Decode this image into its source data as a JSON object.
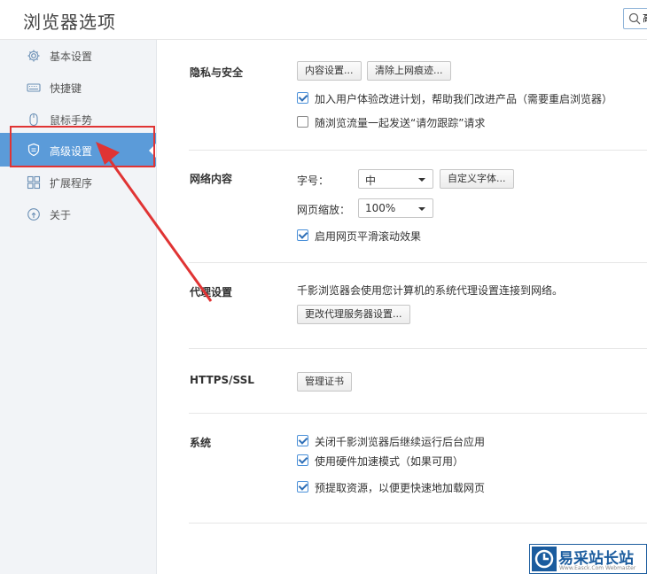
{
  "header": {
    "title": "浏览器选项",
    "search_value": "高",
    "search_icon": "search-icon"
  },
  "sidebar": {
    "items": [
      {
        "label": "基本设置",
        "icon": "gear-icon"
      },
      {
        "label": "快捷键",
        "icon": "keyboard-icon"
      },
      {
        "label": "鼠标手势",
        "icon": "mouse-icon"
      },
      {
        "label": "高级设置",
        "icon": "shield-icon",
        "active": true
      },
      {
        "label": "扩展程序",
        "icon": "extension-grid-icon"
      },
      {
        "label": "关于",
        "icon": "info-icon"
      }
    ]
  },
  "privacy": {
    "label": "隐私与安全",
    "content_settings_button": "内容设置...",
    "clear_history_button": "清除上网痕迹...",
    "ux_program": {
      "label": "加入用户体验改进计划，帮助我们改进产品（需要重启浏览器）",
      "checked": true
    },
    "do_not_track": {
      "label": "随浏览流量一起发送“请勿跟踪”请求",
      "checked": false
    }
  },
  "web_content": {
    "label": "网络内容",
    "font_size_label": "字号：",
    "font_size_value": "中",
    "custom_fonts_button": "自定义字体...",
    "zoom_label": "网页缩放：",
    "zoom_value": "100%",
    "smooth_scroll": {
      "label": "启用网页平滑滚动效果",
      "checked": true
    }
  },
  "proxy": {
    "label": "代理设置",
    "description": "千影浏览器会使用您计算机的系统代理设置连接到网络。",
    "change_button": "更改代理服务器设置..."
  },
  "https": {
    "label": "HTTPS/SSL",
    "manage_certs_button": "管理证书"
  },
  "system": {
    "label": "系统",
    "background_apps": {
      "label": "关闭千影浏览器后继续运行后台应用",
      "checked": true
    },
    "hw_accel": {
      "label": "使用硬件加速模式（如果可用）",
      "checked": true
    },
    "prefetch": {
      "label": "预提取资源，以便更快速地加载网页",
      "checked": true
    }
  },
  "watermark": {
    "text": "易采站长站",
    "sub": "Www.Easck.Com Webmaster"
  },
  "colors": {
    "active_bg": "#5b9bd9",
    "highlight": "#e03434",
    "accent": "#4a90d9"
  }
}
